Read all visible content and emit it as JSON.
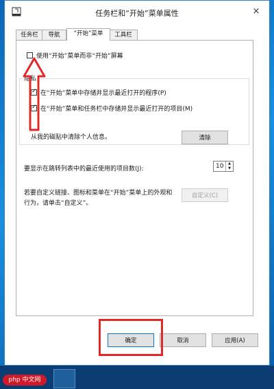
{
  "window": {
    "title": "任务栏和“开始”菜单属性",
    "close_symbol": "×"
  },
  "tabs": [
    {
      "label": "任务栏"
    },
    {
      "label": "导航"
    },
    {
      "label": "“开始”菜单"
    },
    {
      "label": "工具栏"
    }
  ],
  "start_screen": {
    "label": "使用“开始”菜单而非“开始”屏幕",
    "checked": false
  },
  "privacy": {
    "title": "隐私",
    "recent_programs": {
      "label": "在“开始”菜单中存储并显示最近打开的程序(P)",
      "checked": true
    },
    "recent_items": {
      "label": "在“开始”菜单和任务栏中存储并显示最近打开的项目(M)",
      "checked": true
    },
    "clear_text": "从我的磁贴中清除个人信息。",
    "clear_button": "清除"
  },
  "jump_list": {
    "label": "要显示在跳转列表中的最近使用的项目数(J):",
    "value": "10"
  },
  "customize": {
    "text_line1": "若要自定义链接、图标和菜单在“开始”菜单上的外观和",
    "text_line2": "行为，请单击“自定义”。",
    "button": "自定义(C)"
  },
  "footer": {
    "ok": "确定",
    "cancel": "取消",
    "apply": "应用(A)"
  },
  "annotations": {
    "color": "#e02a2a"
  },
  "taskbar": {
    "watermark": "php 中文网"
  }
}
